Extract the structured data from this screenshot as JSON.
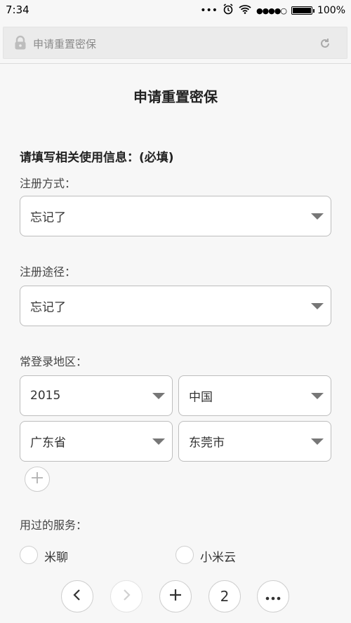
{
  "status_bar": {
    "time": "7:34",
    "signal": "●●●●○",
    "battery_text": "100%"
  },
  "address_bar": {
    "url_text": "申请重置密保",
    "icons": [
      "lock-icon",
      "reload-icon"
    ]
  },
  "page": {
    "title": "申请重置密保",
    "section_title": "请填写相关使用信息：(必填)",
    "register_method": {
      "label": "注册方式：",
      "value": "忘记了"
    },
    "register_channel": {
      "label": "注册途径：",
      "value": "忘记了"
    },
    "login_region": {
      "label": "常登录地区：",
      "year": "2015",
      "country": "中国",
      "province": "广东省",
      "city": "东莞市"
    },
    "services": {
      "label": "用过的服务：",
      "options": [
        "米聊",
        "小米云"
      ]
    }
  },
  "bottom_nav": {
    "tab_count": "2",
    "icons": [
      "back-icon",
      "forward-icon",
      "add-icon",
      "more-icon"
    ]
  },
  "colors": {
    "background": "#f7f7f7",
    "border": "#bdbdbd",
    "text": "#333333"
  }
}
